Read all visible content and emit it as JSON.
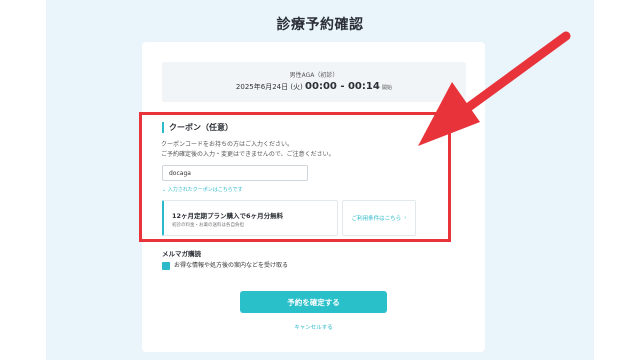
{
  "page": {
    "title": "診療予約確認"
  },
  "booking": {
    "plan": "男性AGA（初診）",
    "date": "2025年6月24日 (火)",
    "time": "00:00 - 00:14",
    "time_suffix": "開始"
  },
  "coupon": {
    "heading": "クーポン（任意）",
    "desc_line1": "クーポンコードをお持ちの方はご入力ください。",
    "desc_line2": "ご予約確定後の入力・変更はできませんので、ご注意ください。",
    "input_value": "docaga",
    "entered_link": "入力されたクーポンはこちらです",
    "card_title": "12ヶ月定期プラン購入で6ヶ月分無料",
    "card_sub": "初診の料金・お薬の送料は各自負担",
    "terms_label": "ご利用条件はこちら"
  },
  "mail": {
    "heading": "メルマガ購読",
    "checkbox_label": "お得な情報や処方後の案内などを受け取る",
    "checked": true
  },
  "actions": {
    "confirm_label": "予約を確定する",
    "cancel_label": "キャンセルする"
  },
  "colors": {
    "accent": "#29c0c9",
    "highlight": "#e8333a",
    "background_panel": "#eaf4fb"
  }
}
